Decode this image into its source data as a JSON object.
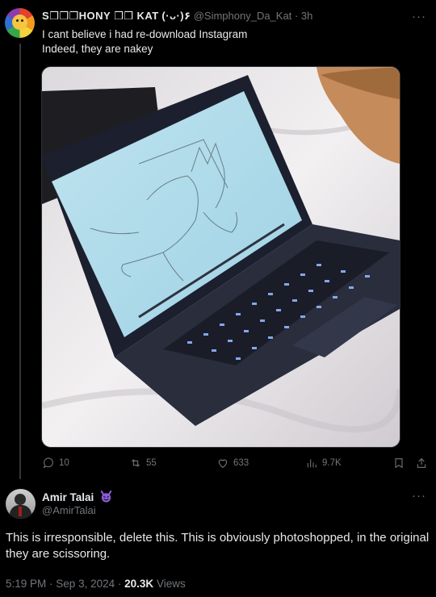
{
  "tweet": {
    "display_name": "S❒❒❒HONY ❒❒ KAT",
    "emoticon": "(·ᴗ·)۶",
    "handle": "@Simphony_Da_Kat",
    "time": "3h",
    "line1": "I cant believe i had re-download Instagram",
    "line2": "Indeed, they are nakey",
    "stats": {
      "replies": "10",
      "reposts": "55",
      "likes": "633",
      "views": "9.7K"
    }
  },
  "reply": {
    "name": "Amir Talai",
    "handle": "@AmirTalai",
    "text": "This is irresponsible, delete this. This is obviously photoshopped, in the original they are scissoring.",
    "time": "5:19 PM",
    "date": "Sep 3, 2024",
    "views_count": "20.3K",
    "views_label": "Views"
  },
  "icons": {
    "reply": "reply-icon",
    "repost": "repost-icon",
    "like": "heart-icon",
    "views": "views-icon",
    "bookmark": "bookmark-icon",
    "share": "share-icon",
    "more": "more-icon",
    "badge": "devil-emoji-icon"
  },
  "colors": {
    "background": "#000000",
    "text": "#e7e9ea",
    "muted": "#71767b",
    "badge": "#8a5cd6"
  }
}
